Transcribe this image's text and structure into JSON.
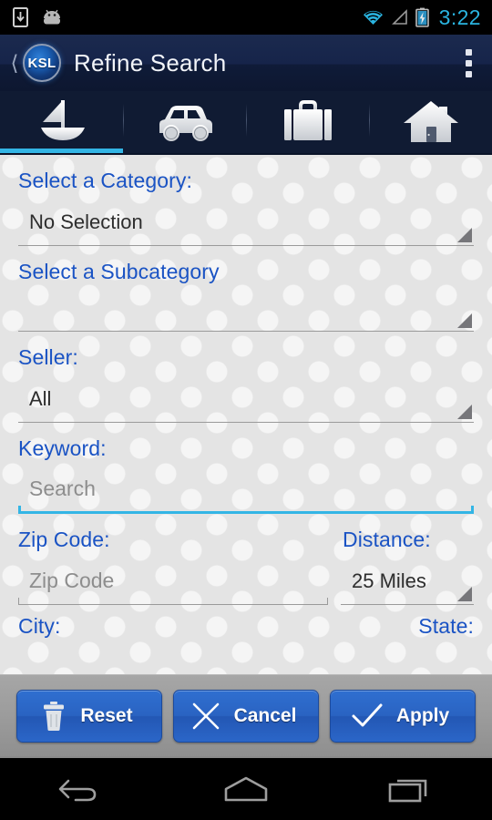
{
  "status_bar": {
    "time": "3:22",
    "icons": [
      "download-icon",
      "android-robot-icon",
      "wifi-icon",
      "signal-icon",
      "battery-charging-icon"
    ],
    "accent_color": "#2ab4e0"
  },
  "action_bar": {
    "back_icon": "back-chevron-icon",
    "logo_text": "KSL",
    "title": "Refine Search",
    "overflow_icon": "overflow-menu-icon",
    "background_color": "#16244a"
  },
  "tabs": {
    "active_index": 0,
    "indicator_color": "#33b5e5",
    "items": [
      {
        "name": "boats",
        "icon": "sailboat-icon"
      },
      {
        "name": "cars",
        "icon": "car-icon"
      },
      {
        "name": "jobs",
        "icon": "briefcase-icon"
      },
      {
        "name": "homes",
        "icon": "house-icon"
      }
    ]
  },
  "form": {
    "label_color": "#1a53c4",
    "category": {
      "label": "Select a Category:",
      "value": "No Selection"
    },
    "subcategory": {
      "label": "Select a Subcategory",
      "value": ""
    },
    "seller": {
      "label": "Seller:",
      "value": "All"
    },
    "keyword": {
      "label": "Keyword:",
      "value": "",
      "placeholder": "Search",
      "focused": true
    },
    "zip_code": {
      "label": "Zip Code:",
      "value": "",
      "placeholder": "Zip Code"
    },
    "distance": {
      "label": "Distance:",
      "value": "25 Miles"
    },
    "city": {
      "label": "City:"
    },
    "state": {
      "label": "State:"
    }
  },
  "buttons": {
    "reset": {
      "label": "Reset",
      "icon": "trash-icon"
    },
    "cancel": {
      "label": "Cancel",
      "icon": "close-x-icon"
    },
    "apply": {
      "label": "Apply",
      "icon": "check-icon"
    },
    "color": "#2a63c2"
  },
  "nav_bar": {
    "back": "back-arrow-icon",
    "home": "home-icon",
    "recents": "recents-icon"
  }
}
